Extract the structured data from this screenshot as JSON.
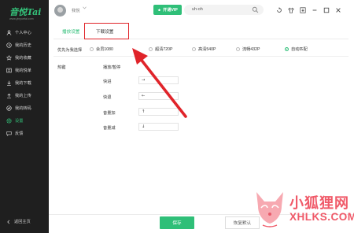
{
  "app": {
    "logo": "音悦Tai",
    "logo_sub": "www.yinyuetai.com",
    "accent_color": "#2fbf78"
  },
  "sidebar": {
    "items": [
      {
        "label": "个人中心",
        "icon": "user-icon"
      },
      {
        "label": "我的历史",
        "icon": "clock-icon"
      },
      {
        "label": "我的收藏",
        "icon": "star-icon"
      },
      {
        "label": "我的悦单",
        "icon": "list-icon"
      },
      {
        "label": "我的下载",
        "icon": "download-icon"
      },
      {
        "label": "我的上传",
        "icon": "upload-icon"
      },
      {
        "label": "我的转码",
        "icon": "convert-icon"
      },
      {
        "label": "设置",
        "icon": "gear-icon",
        "active": true
      },
      {
        "label": "反馈",
        "icon": "feedback-icon"
      }
    ],
    "back_home": "返回主页"
  },
  "header": {
    "username": "我悦",
    "open_vip": "开通VIP",
    "search_value": "uh-oh",
    "icons": [
      "settings-icon",
      "skin-icon",
      "download-icon",
      "minimize-icon",
      "maximize-icon",
      "close-icon"
    ]
  },
  "tabs": {
    "play": "播放设置",
    "download": "下载设置"
  },
  "quality": {
    "label": "优先为我选择",
    "options": [
      "会员1080",
      "超清720P",
      "高清540P",
      "流畅432P",
      "自动匹配"
    ],
    "selected": "自动匹配"
  },
  "hotkeys": {
    "label": "热键",
    "rows": [
      {
        "label": "播放/暂停",
        "value": ""
      },
      {
        "label": "快进",
        "value": "→"
      },
      {
        "label": "快退",
        "value": "←"
      },
      {
        "label": "音量加",
        "value": "↑"
      },
      {
        "label": "音量减",
        "value": "↓"
      }
    ]
  },
  "footer": {
    "save": "保存",
    "restore_default": "恢复默认"
  },
  "watermark": {
    "text": "小狐狸网",
    "sub": "XHLKS.COM"
  }
}
